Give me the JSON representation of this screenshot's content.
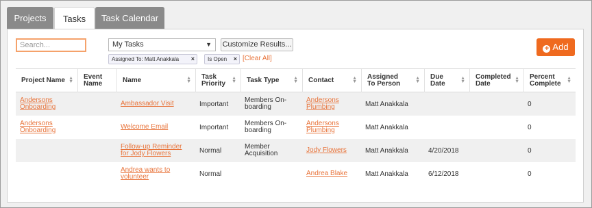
{
  "tabs": [
    {
      "label": "Projects",
      "active": false
    },
    {
      "label": "Tasks",
      "active": true
    },
    {
      "label": "Task Calendar",
      "active": false
    }
  ],
  "toolbar": {
    "search_placeholder": "Search...",
    "view_select": "My Tasks",
    "customize_label": "Customize Results...",
    "add_label": "Add",
    "clear_all_label": "[Clear All]"
  },
  "filters": [
    {
      "label": "Assigned To: Matt Anakkala"
    },
    {
      "label": "Is Open"
    }
  ],
  "columns": [
    "Project Name",
    "Event Name",
    "Name",
    "Task Priority",
    "Task Type",
    "Contact",
    "Assigned To Person",
    "Due Date",
    "Completed Date",
    "Percent Complete"
  ],
  "rows": [
    {
      "project": "Andersons Onboarding",
      "event": "",
      "name": "Ambassador Visit",
      "priority": "Important",
      "type": "Members On-boarding",
      "contact": "Andersons Plumbing",
      "assigned": "Matt Anakkala",
      "due": "",
      "completed": "",
      "percent": "0"
    },
    {
      "project": "Andersons Onboarding",
      "event": "",
      "name": "Welcome Email",
      "priority": "Important",
      "type": "Members On-boarding",
      "contact": "Andersons Plumbing",
      "assigned": "Matt Anakkala",
      "due": "",
      "completed": "",
      "percent": "0"
    },
    {
      "project": "",
      "event": "",
      "name": "Follow-up Reminder for Jody Flowers",
      "priority": "Normal",
      "type": "Member Acquisition",
      "contact": "Jody Flowers",
      "assigned": "Matt Anakkala",
      "due": "4/20/2018",
      "completed": "",
      "percent": "0"
    },
    {
      "project": "",
      "event": "",
      "name": "Andrea wants to volunteer",
      "priority": "Normal",
      "type": "",
      "contact": "Andrea Blake",
      "assigned": "Matt Anakkala",
      "due": "6/12/2018",
      "completed": "",
      "percent": "0"
    }
  ],
  "colors": {
    "accent": "#ef6a1f",
    "link": "#e8743b",
    "tab_inactive": "#8a8a8a"
  }
}
